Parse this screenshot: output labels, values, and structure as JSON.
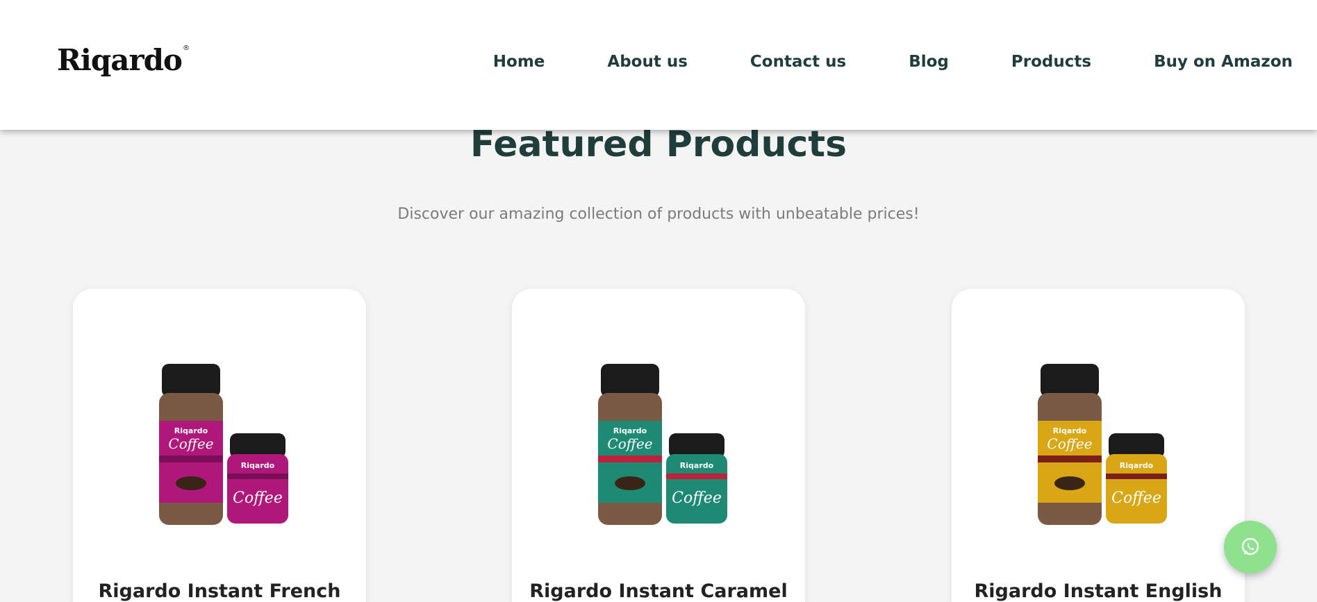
{
  "header": {
    "logo": "Riqardo",
    "logo_mark": "®",
    "nav": [
      {
        "label": "Home"
      },
      {
        "label": "About us"
      },
      {
        "label": "Contact us"
      },
      {
        "label": "Blog"
      },
      {
        "label": "Products"
      },
      {
        "label": "Buy on Amazon"
      }
    ]
  },
  "featured": {
    "title": "Featured Products",
    "subtitle": "Discover our amazing collection of products with unbeatable prices!",
    "products": [
      {
        "name": "Rigardo Instant French",
        "label_color": "#b0177a",
        "band_color": "#7a0f57"
      },
      {
        "name": "Rigardo Instant Caramel",
        "label_color": "#1f8a73",
        "band_color": "#c0203a"
      },
      {
        "name": "Rigardo Instant English",
        "label_color": "#d9a716",
        "band_color": "#7a1f1a"
      }
    ]
  },
  "whatsapp": {
    "icon": "whatsapp-icon",
    "color": "#8ee28e"
  }
}
